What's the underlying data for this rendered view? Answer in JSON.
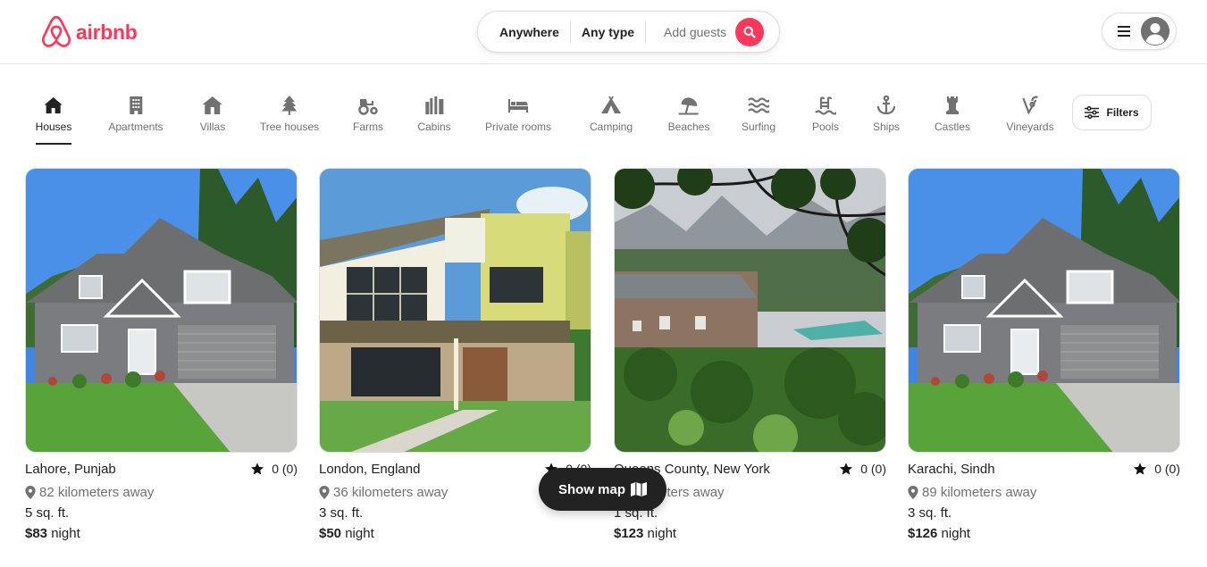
{
  "brand": {
    "name": "airbnb",
    "color": "#ff385c",
    "logo_icon": "airbnb-logo-icon"
  },
  "search": {
    "where": "Anywhere",
    "type": "Any type",
    "guests_placeholder": "Add guests",
    "button_icon": "search-icon"
  },
  "user_menu": {
    "menu_icon": "hamburger-icon",
    "avatar_icon": "user-avatar-icon"
  },
  "categories": [
    {
      "label": "Houses",
      "icon": "house-icon",
      "active": true
    },
    {
      "label": "Apartments",
      "icon": "building-icon"
    },
    {
      "label": "Villas",
      "icon": "villa-icon"
    },
    {
      "label": "Tree houses",
      "icon": "tree-icon"
    },
    {
      "label": "Farms",
      "icon": "tractor-icon"
    },
    {
      "label": "Cabins",
      "icon": "cabin-icon"
    },
    {
      "label": "Private rooms",
      "icon": "bed-icon"
    },
    {
      "label": "Camping",
      "icon": "tent-icon"
    },
    {
      "label": "Beaches",
      "icon": "umbrella-icon"
    },
    {
      "label": "Surfing",
      "icon": "water-icon"
    },
    {
      "label": "Pools",
      "icon": "pool-icon"
    },
    {
      "label": "Ships",
      "icon": "anchor-icon"
    },
    {
      "label": "Castles",
      "icon": "castle-icon"
    },
    {
      "label": "Vineyards",
      "icon": "vineyard-icon"
    }
  ],
  "filters": {
    "label": "Filters",
    "icon": "sliders-icon"
  },
  "listings": [
    {
      "location": "Lahore, Punjab",
      "rating": "0 (0)",
      "distance": "82 kilometers away",
      "size": "5 sq. ft.",
      "price": "$83",
      "price_unit": "night"
    },
    {
      "location": "London, England",
      "rating": "0 (0)",
      "distance": "36 kilometers away",
      "size": "3 sq. ft.",
      "price": "$50",
      "price_unit": "night"
    },
    {
      "location": "Queens County, New York",
      "rating": "0 (0)",
      "distance": "kilometers away",
      "size": "1 sq. ft.",
      "price": "$123",
      "price_unit": "night"
    },
    {
      "location": "Karachi, Sindh",
      "rating": "0 (0)",
      "distance": "89 kilometers away",
      "size": "3 sq. ft.",
      "price": "$126",
      "price_unit": "night"
    }
  ],
  "show_map": {
    "label": "Show map",
    "icon": "map-icon"
  }
}
